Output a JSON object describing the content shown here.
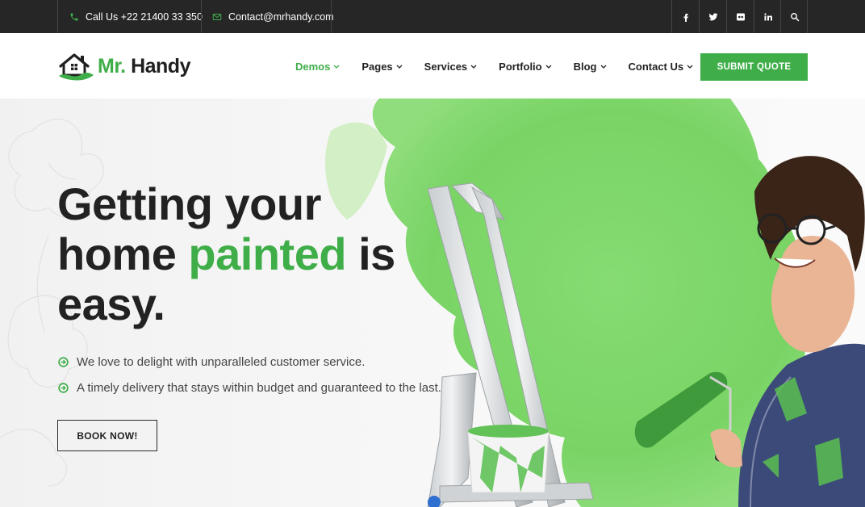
{
  "topbar": {
    "phone": "Call Us +22 21400 33 350",
    "email": "Contact@mrhandy.com",
    "social": [
      {
        "icon": "facebook-icon"
      },
      {
        "icon": "twitter-icon"
      },
      {
        "icon": "flickr-icon"
      },
      {
        "icon": "linkedin-icon"
      },
      {
        "icon": "search-icon"
      }
    ]
  },
  "header": {
    "logo": {
      "mr": "Mr.",
      "name": "Handy"
    },
    "nav": [
      {
        "label": "Demos",
        "active": true
      },
      {
        "label": "Pages"
      },
      {
        "label": "Services"
      },
      {
        "label": "Portfolio"
      },
      {
        "label": "Blog"
      },
      {
        "label": "Contact Us"
      }
    ],
    "cta": "SUBMIT QUOTE"
  },
  "hero": {
    "headline_line1": "Getting your",
    "headline_line2_a": "home ",
    "headline_line2_accent": "painted",
    "headline_line2_b": " is",
    "headline_line3": "easy.",
    "bullets": [
      "We love to delight with unparalleled customer service.",
      "A timely delivery that stays within budget and guaranteed to the last."
    ],
    "button": "BOOK NOW!"
  },
  "colors": {
    "accent": "#3fae49",
    "topbar_bg": "#262626",
    "paint_green": "#7ed86b"
  }
}
